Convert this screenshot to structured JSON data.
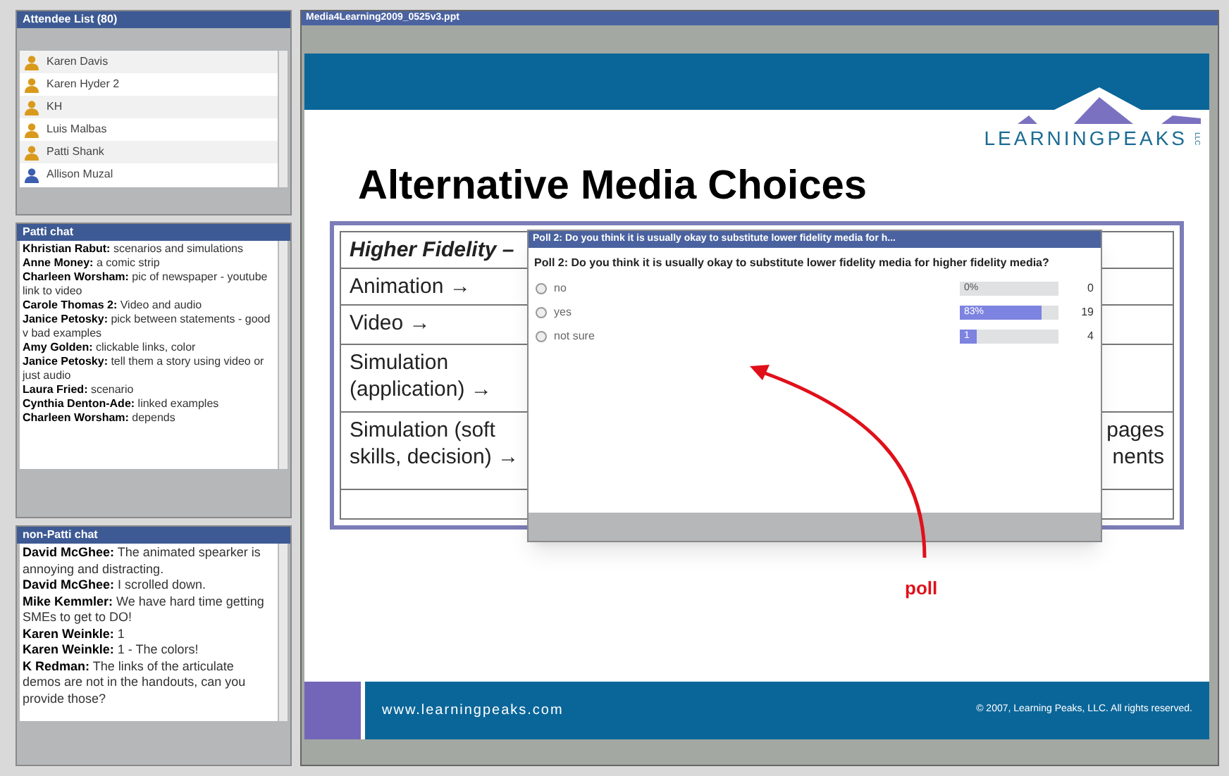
{
  "attendee_panel": {
    "title": "Attendee List (80)",
    "attendees": [
      {
        "name": "Karen Davis",
        "kind": "presenter"
      },
      {
        "name": "Karen Hyder 2",
        "kind": "presenter"
      },
      {
        "name": "KH",
        "kind": "presenter"
      },
      {
        "name": "Luis Malbas",
        "kind": "presenter"
      },
      {
        "name": "Patti Shank",
        "kind": "presenter"
      },
      {
        "name": "Allison Muzal",
        "kind": "attendee"
      }
    ]
  },
  "chat_panels": [
    {
      "title": "Patti chat",
      "messages": [
        {
          "sender": "Khristian Rabut:",
          "text": "scenarios and simulations"
        },
        {
          "sender": "Anne Money:",
          "text": "a comic strip"
        },
        {
          "sender": "Charleen Worsham:",
          "text": "pic of newspaper - youtube link to video"
        },
        {
          "sender": "Carole Thomas 2:",
          "text": "Video and audio"
        },
        {
          "sender": "Janice Petosky:",
          "text": "pick between statements - good v bad examples"
        },
        {
          "sender": "Amy Golden:",
          "text": "clickable links, color"
        },
        {
          "sender": "Janice Petosky:",
          "text": "tell them a story using video or just audio"
        },
        {
          "sender": "Laura Fried:",
          "text": "scenario"
        },
        {
          "sender": "Cynthia Denton-Ade:",
          "text": "linked examples"
        },
        {
          "sender": "Charleen Worsham:",
          "text": "depends"
        }
      ]
    },
    {
      "title": "non-Patti chat",
      "messages": [
        {
          "sender": "David McGhee:",
          "text": "The animated spearker is annoying and distracting."
        },
        {
          "sender": "David McGhee:",
          "text": "I scrolled down."
        },
        {
          "sender": "Mike Kemmler:",
          "text": "We have hard time getting SMEs to get to DO!"
        },
        {
          "sender": "Karen Weinkle:",
          "text": "1"
        },
        {
          "sender": "Karen Weinkle:",
          "text": "1 -  The colors!"
        },
        {
          "sender": "K Redman:",
          "text": "The links of the articulate demos are not in the handouts, can you provide those?"
        }
      ]
    }
  ],
  "presentation": {
    "title": "Media4Learning2009_0525v3.ppt",
    "slide": {
      "logo_text": "LEARNINGPEAKS",
      "logo_suffix": "LLC",
      "heading": "Alternative Media Choices",
      "table_rows": [
        {
          "column_1": "Higher Fidelity –",
          "column_2": "",
          "kind": "header"
        },
        {
          "column_1": "Animation →",
          "column_2": ""
        },
        {
          "column_1": "Video →",
          "column_2": ""
        },
        {
          "column_1": "Simulation (application) →",
          "column_2": ""
        },
        {
          "column_1": "Simulation (soft skills, decision) →",
          "column_2": "pages\nnents"
        }
      ],
      "footer_url": "www.learningpeaks.com",
      "footer_copyright": "© 2007, Learning Peaks, LLC.  All rights reserved."
    }
  },
  "poll": {
    "title": "Poll 2: Do you think it is usually okay to substitute lower fidelity media for h...",
    "question": "Poll 2: Do you think it is usually okay to substitute lower fidelity media for higher fidelity media?",
    "options": [
      {
        "label": "no",
        "selected": false,
        "level": 0,
        "percent": "0%",
        "count": "0"
      },
      {
        "label": "yes",
        "selected": false,
        "level": 0.83,
        "percent": "83%",
        "count": "19"
      },
      {
        "label": "not sure",
        "selected": false,
        "level": 0.17,
        "percent": "1",
        "count": "4"
      }
    ]
  },
  "annotation": {
    "label": "poll"
  }
}
